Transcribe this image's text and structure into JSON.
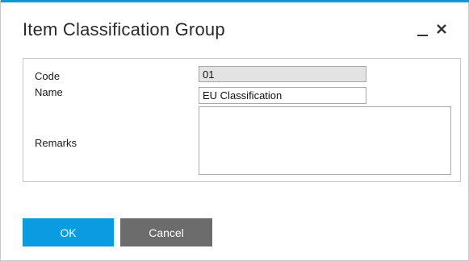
{
  "window": {
    "title": "Item Classification Group",
    "accent_color": "#0a9ad9",
    "controls": {
      "minimize_icon": "minimize-icon",
      "close_icon": "close-icon"
    }
  },
  "form": {
    "code": {
      "label": "Code",
      "value": "01"
    },
    "name": {
      "label": "Name",
      "value": "EU Classification"
    },
    "remarks": {
      "label": "Remarks",
      "value": ""
    }
  },
  "buttons": {
    "ok_label": "OK",
    "ok_color": "#0b9be1",
    "cancel_label": "Cancel",
    "cancel_color": "#6c6c6c"
  }
}
